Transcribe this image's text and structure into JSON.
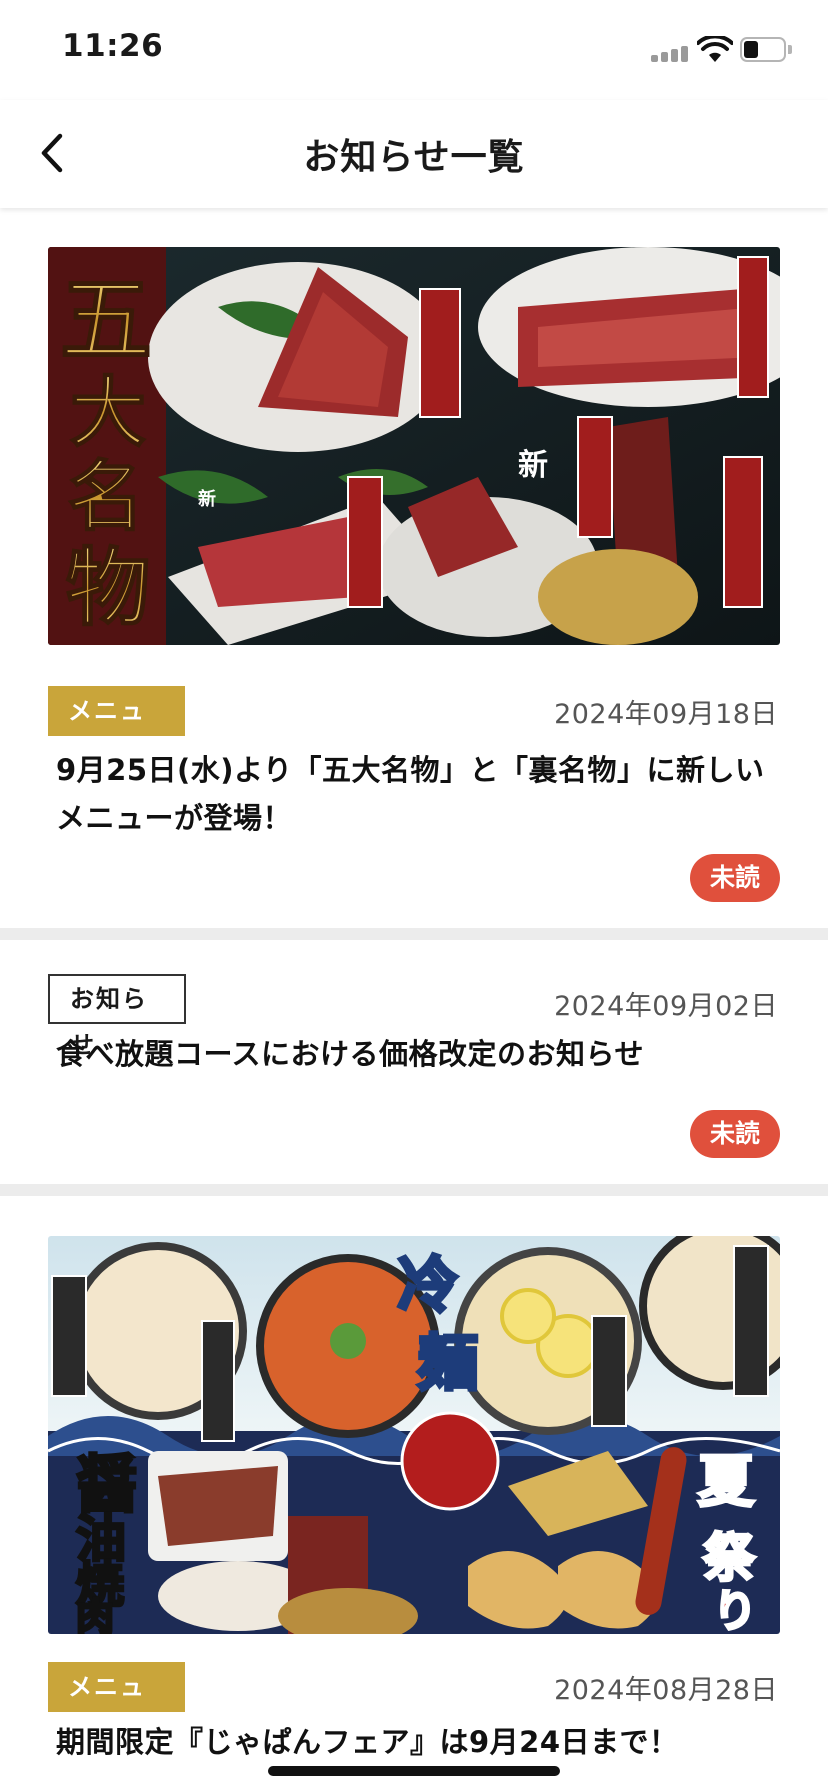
{
  "status_bar": {
    "time": "11:26"
  },
  "header": {
    "title": "お知らせ一覧",
    "back_icon": "chevron-left-icon"
  },
  "notices": [
    {
      "image": "five-famous-dishes-meat-banner",
      "banner_text": "五大名物",
      "tag": "メニュー",
      "date": "2024年09月18日",
      "title": "9月25日(水)より「五大名物」と「裏名物」に新しいメニューが登場！",
      "status": "未読"
    },
    {
      "tag": "お知らせ",
      "date": "2024年09月02日",
      "title": "食べ放題コースにおける価格改定のお知らせ",
      "status": "未読"
    },
    {
      "image": "cold-noodle-summer-festival-banner",
      "banner_text_left": "醤油焼肉",
      "banner_text_center": "冷麺",
      "banner_text_right": "夏祭り",
      "tag": "メニュー",
      "date": "2024年08月28日",
      "title": "期間限定『じゃぱんフェア』は9月24日まで！"
    }
  ],
  "colors": {
    "menu_tag": "#c9a53a",
    "unread_badge": "#e0503c",
    "separator": "#ececec"
  }
}
